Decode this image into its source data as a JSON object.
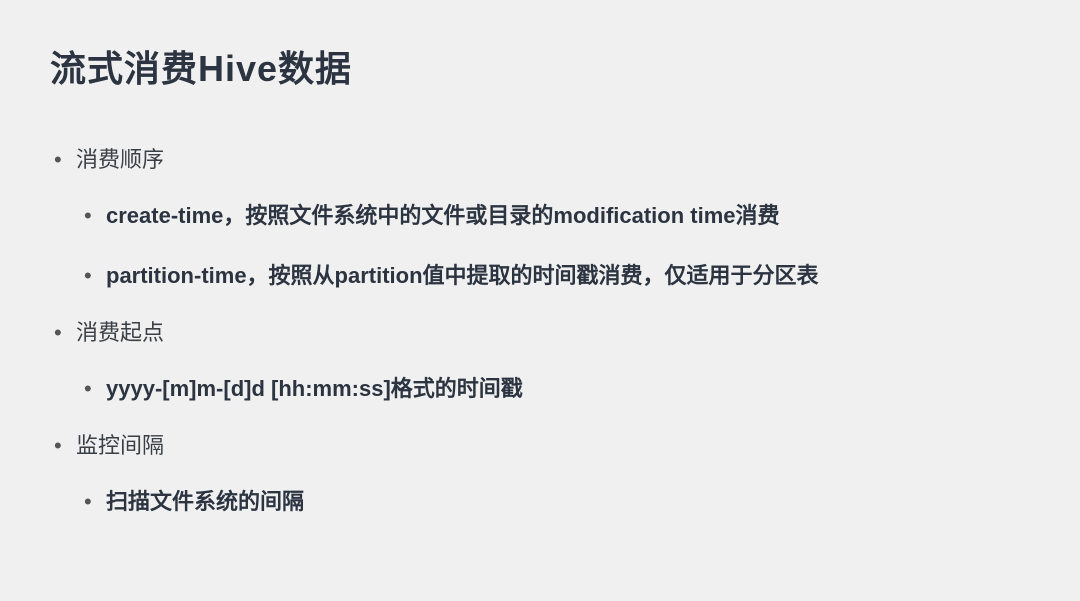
{
  "title": "流式消费Hive数据",
  "items": [
    {
      "label": "消费顺序",
      "children": [
        {
          "label": "create-time，按照文件系统中的文件或目录的modification time消费"
        },
        {
          "label": "partition-time，按照从partition值中提取的时间戳消费，仅适用于分区表"
        }
      ]
    },
    {
      "label": "消费起点",
      "children": [
        {
          "label": "yyyy-[m]m-[d]d [hh:mm:ss]格式的时间戳"
        }
      ]
    },
    {
      "label": "监控间隔",
      "children": [
        {
          "label": "扫描文件系统的间隔"
        }
      ]
    }
  ]
}
